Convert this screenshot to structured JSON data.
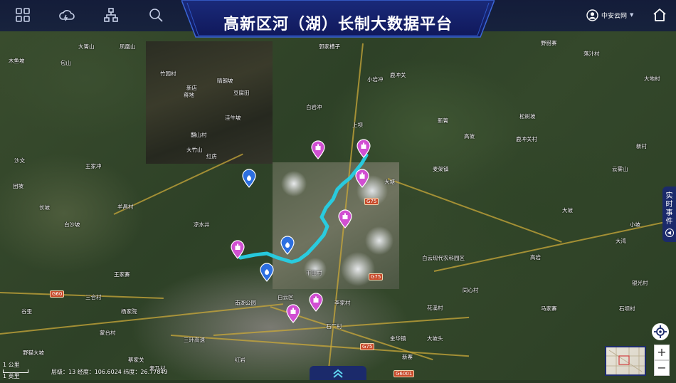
{
  "header": {
    "title": "高新区河（湖）长制大数据平台",
    "nav_icons": [
      "dashboard-grid-icon",
      "weather-cloud-icon",
      "org-structure-icon",
      "search-icon"
    ],
    "user_name": "中安云网",
    "home_icon": "home-icon"
  },
  "side_panel": {
    "tab_label": "实时事件"
  },
  "map_controls": {
    "zoom_in": "+",
    "zoom_out": "−",
    "locate_icon": "locate-icon"
  },
  "status_bar": {
    "text": "层级：13  经度：106.6024  纬度：26.77849"
  },
  "scale_bar": {
    "metric": "1 公里",
    "imperial": "1 英里"
  },
  "map_labels": [
    {
      "text": "木鱼坡"
    },
    {
      "text": "包山"
    },
    {
      "text": "大箐山"
    },
    {
      "text": "凤凰山"
    },
    {
      "text": "郭家槽子"
    },
    {
      "text": "野腊寨"
    },
    {
      "text": "落汁村"
    },
    {
      "text": "竹园村"
    },
    {
      "text": "晴朗坡"
    },
    {
      "text": "豆腐田"
    },
    {
      "text": "新店"
    },
    {
      "text": "蒋地"
    },
    {
      "text": "洼牛坡"
    },
    {
      "text": "翻山村"
    },
    {
      "text": "大竹山"
    },
    {
      "text": "红房"
    },
    {
      "text": "白岩冲"
    },
    {
      "text": "鹿冲关"
    },
    {
      "text": "小岩冲"
    },
    {
      "text": "上坝"
    },
    {
      "text": "新箐"
    },
    {
      "text": "高坡"
    },
    {
      "text": "鹿冲关村"
    },
    {
      "text": "松树坡"
    },
    {
      "text": "大地村"
    },
    {
      "text": "新村"
    },
    {
      "text": "云雾山"
    },
    {
      "text": "大坡"
    },
    {
      "text": "小坡"
    },
    {
      "text": "高岩"
    },
    {
      "text": "大湾"
    },
    {
      "text": "白云现代农科园区"
    },
    {
      "text": "大塘"
    },
    {
      "text": "麦架镇"
    },
    {
      "text": "干田村"
    },
    {
      "text": "石厂村"
    },
    {
      "text": "李家村"
    },
    {
      "text": "同心村"
    },
    {
      "text": "花溪村"
    },
    {
      "text": "马家寨"
    },
    {
      "text": "王家寨"
    },
    {
      "text": "沙文"
    },
    {
      "text": "长坡"
    },
    {
      "text": "白沙坡"
    },
    {
      "text": "野猫大坡"
    },
    {
      "text": "蒙台村"
    },
    {
      "text": "杨家院"
    },
    {
      "text": "三合村"
    },
    {
      "text": "蔡家关"
    },
    {
      "text": "三环高速"
    },
    {
      "text": "南湖公园"
    },
    {
      "text": "白云区"
    },
    {
      "text": "金华镇"
    },
    {
      "text": "新寨"
    },
    {
      "text": "大坡头"
    },
    {
      "text": "湾子"
    },
    {
      "text": "银光村"
    },
    {
      "text": "石坝村"
    },
    {
      "text": "谷歪"
    },
    {
      "text": "麦乃村"
    },
    {
      "text": "王家冲"
    },
    {
      "text": "羊昌村"
    },
    {
      "text": "凉水井"
    },
    {
      "text": "红岩"
    },
    {
      "text": "团坡"
    }
  ],
  "road_shields": [
    {
      "text": "G75"
    },
    {
      "text": "G75"
    },
    {
      "text": "G75"
    },
    {
      "text": "G60"
    },
    {
      "text": "G6001"
    }
  ],
  "markers": [
    {
      "icon": "monitoring-station-pin-icon",
      "color": "#d14fd2"
    },
    {
      "icon": "monitoring-station-pin-icon",
      "color": "#d14fd2"
    },
    {
      "icon": "monitoring-station-pin-icon",
      "color": "#d14fd2"
    },
    {
      "icon": "monitoring-station-pin-icon",
      "color": "#d14fd2"
    },
    {
      "icon": "monitoring-station-pin-icon",
      "color": "#d14fd2"
    },
    {
      "icon": "monitoring-station-pin-icon",
      "color": "#d14fd2"
    },
    {
      "icon": "monitoring-station-pin-icon",
      "color": "#d14fd2"
    },
    {
      "icon": "water-facility-pin-icon",
      "color": "#2d6fe0"
    },
    {
      "icon": "water-facility-pin-icon",
      "color": "#2d6fe0"
    },
    {
      "icon": "water-facility-pin-icon",
      "color": "#2d6fe0"
    }
  ],
  "colors": {
    "header_bg": "#121a3a",
    "accent_blue": "#1b2a6b",
    "river_highlight": "#26d0e6",
    "pin_magenta": "#d14fd2",
    "pin_blue": "#2d6fe0"
  }
}
